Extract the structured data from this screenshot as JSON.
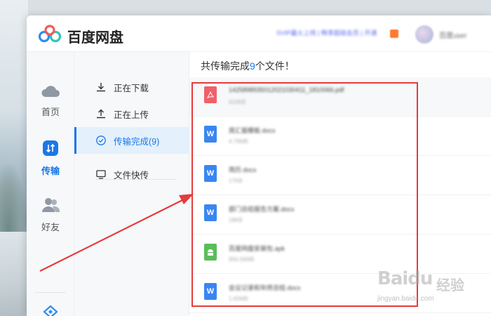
{
  "app": {
    "title": "百度网盘",
    "promo_text": "SVIP最火上线 | 畅享超级会员 | 开通",
    "username": "百度user"
  },
  "rail": {
    "items": [
      {
        "label": "首页",
        "icon": "cloud-icon",
        "active": false
      },
      {
        "label": "传输",
        "icon": "transfer-icon",
        "active": true
      },
      {
        "label": "好友",
        "icon": "friends-icon",
        "active": false
      }
    ]
  },
  "nav": {
    "items": [
      {
        "label": "正在下载",
        "icon": "download-icon"
      },
      {
        "label": "正在上传",
        "icon": "upload-icon"
      },
      {
        "label": "传输完成(9)",
        "icon": "check-circle-icon",
        "active": true
      },
      {
        "label": "文件快传",
        "icon": "monitor-icon"
      }
    ]
  },
  "content": {
    "summary_prefix": "共传输完成",
    "summary_count": "9",
    "summary_suffix": "个文件！",
    "files": [
      {
        "name": "1425898935012021030411_1810066.pdf",
        "size": "410KB",
        "type": "pdf",
        "icon": "pdf-file-icon"
      },
      {
        "name": "周汇报模板.docx",
        "size": "4.79MB",
        "type": "doc",
        "icon": "word-file-icon"
      },
      {
        "name": "简历.docx",
        "size": "17KB",
        "type": "doc",
        "icon": "word-file-icon"
      },
      {
        "name": "部门总结报告方案.docx",
        "size": "18KB",
        "type": "doc",
        "icon": "word-file-icon"
      },
      {
        "name": "百度网盘安装包.apk",
        "size": "956.56MB",
        "type": "apk",
        "icon": "android-file-icon"
      },
      {
        "name": "会议记录和年终总结.docx",
        "size": "1.65MB",
        "type": "doc",
        "icon": "word-file-icon"
      }
    ]
  },
  "watermark": {
    "brand": "Baidu",
    "cn": "经验",
    "url": "jingyan.baidu.com"
  },
  "annotation": {
    "color": "#e53b3b"
  },
  "colors": {
    "accent": "#1a78e6",
    "pdf": "#f0606a",
    "word": "#3a86f1",
    "apk": "#5bbd5a"
  }
}
